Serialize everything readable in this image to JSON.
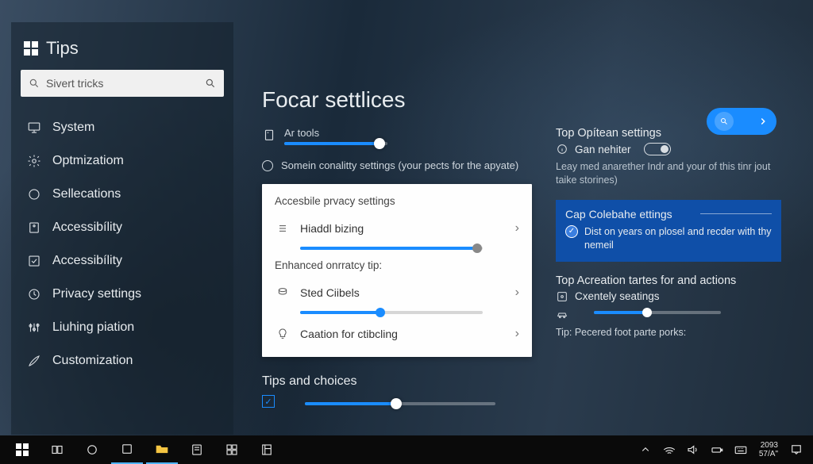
{
  "sidebar": {
    "title": "Tips",
    "search_placeholder": "Sivert tricks",
    "items": [
      {
        "label": "System"
      },
      {
        "label": "Optmizatiom"
      },
      {
        "label": "Sellecations"
      },
      {
        "label": "Accessibílity"
      },
      {
        "label": "Accessibílity"
      },
      {
        "label": "Privacy settings"
      },
      {
        "label": "Liuhing piation"
      },
      {
        "label": "Customization"
      }
    ]
  },
  "main": {
    "title": "Focar settlices",
    "ar_tools_label": "Ar tools",
    "ar_tools_pct": 92,
    "radio_label": "Somein conalitty settings (your pects for the apyate)",
    "card": {
      "heading1": "Accesbile prvacy settings",
      "row1": "Hiaddl bizing",
      "row1_pct": 97,
      "heading2": "Enhanced onrratcy tip:",
      "row2": "Sted Ciibels",
      "row2_pct": 44,
      "row3": "Caation for ctibcling"
    },
    "tips_heading": "Tips and choices",
    "tips_slider_pct": 48
  },
  "right": {
    "sec1_title": "Top Opítean settings",
    "sec1_line": "Gan nehiter",
    "sec1_desc": "Leay med anarether Indr and your of this tinr jout taike storines)",
    "bluebox_title": "Cap Colebahe ettings",
    "bluebox_desc": "Dist on years on plosel and recder with thy nemeil",
    "sec3_title": "Top Acreation tartes for and actions",
    "sec3_line": "Cxentely seatings",
    "sec3_slider_pct": 42,
    "sec3_tip": "Tip: Pecered foot parte porks:"
  },
  "taskbar": {
    "clock_time": "2093",
    "clock_sub": "57/A\""
  }
}
